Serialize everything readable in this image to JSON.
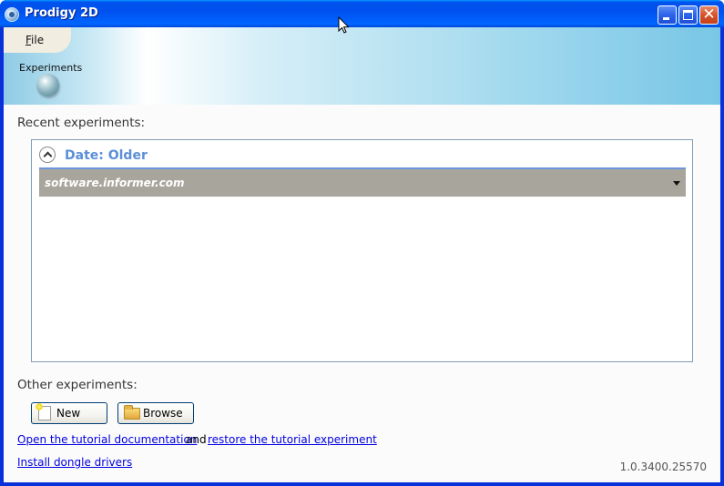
{
  "window": {
    "title": "Prodigy 2D",
    "controls": {
      "minimize": "minimize",
      "maximize": "maximize",
      "close": "close"
    }
  },
  "menu": {
    "file_label": "File",
    "file_mnemonic": "F",
    "file_rest": "ile"
  },
  "ribbon": {
    "experiments_label": "Experiments"
  },
  "recent": {
    "heading": "Recent experiments:",
    "group_title": "Date:  Older",
    "items": [
      {
        "name": "software.informer.com"
      }
    ]
  },
  "other": {
    "heading": "Other experiments:",
    "new_label": "New",
    "browse_label": "Browse"
  },
  "links": {
    "tutorial_doc": "Open the tutorial documentation",
    "and_text": "and",
    "restore_tutorial": "restore the tutorial experiment",
    "dongle_drivers": "Install dongle drivers"
  },
  "version": "1.0.3400.25570"
}
